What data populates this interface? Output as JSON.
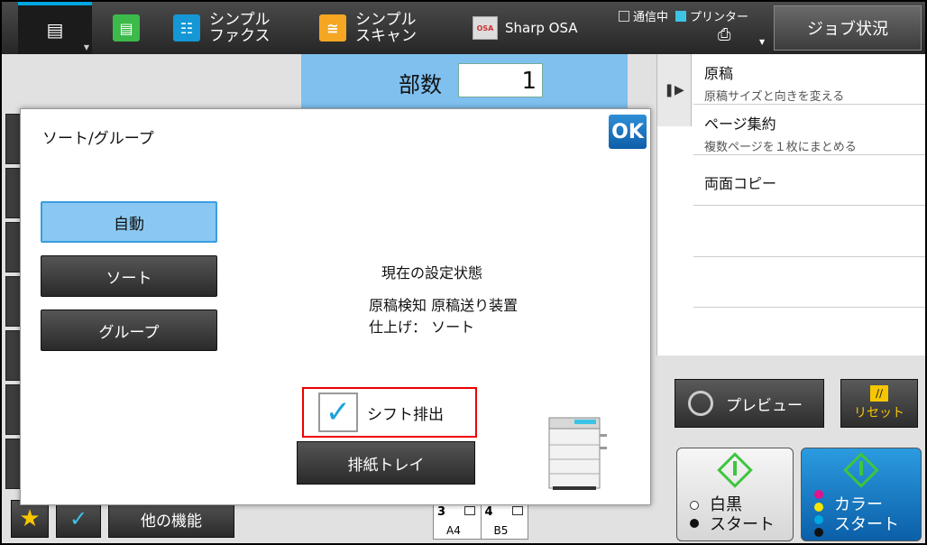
{
  "topbar": {
    "fax_label": "シンプル\nファクス",
    "scan_label": "シンプル\nスキャン",
    "osa_label": "Sharp OSA",
    "osa_icon_text": "OSA",
    "status_comm": "通信中",
    "status_printer": "プリンター",
    "job_status": "ジョブ状況"
  },
  "copies": {
    "label": "部数",
    "value": "1"
  },
  "right_panel": {
    "items": [
      {
        "title": "原稿",
        "subtitle": "原稿サイズと向きを変える"
      },
      {
        "title": "ページ集約",
        "subtitle": "複数ページを１枚にまとめる"
      },
      {
        "title": "両面コピー",
        "subtitle": ""
      }
    ]
  },
  "dialog": {
    "title": "ソート/グループ",
    "ok": "OK",
    "options": [
      {
        "label": "自動",
        "selected": true
      },
      {
        "label": "ソート",
        "selected": false
      },
      {
        "label": "グループ",
        "selected": false
      }
    ],
    "state_heading": "現在の設定状態",
    "state_line1": "原稿検知 原稿送り装置",
    "state_line2": "仕上げ： ソート",
    "shift_label": "シフト排出",
    "shift_checked": true,
    "tray_button": "排紙トレイ"
  },
  "bottom": {
    "other_functions": "他の機能",
    "trays": [
      {
        "num": "3",
        "size": "A4"
      },
      {
        "num": "4",
        "size": "B5"
      }
    ]
  },
  "actions": {
    "preview": "プレビュー",
    "reset": "リセット",
    "bw_start": "白黒\nスタート",
    "color_start": "カラー\nスタート"
  },
  "colors": {
    "accent": "#00a7e1",
    "selected_option": "#8ac8f2",
    "highlight_border": "#e00000",
    "start_icon": "#3ec63e",
    "color_start_bg": "#0b5fa8",
    "reset_icon": "#f7c600"
  }
}
